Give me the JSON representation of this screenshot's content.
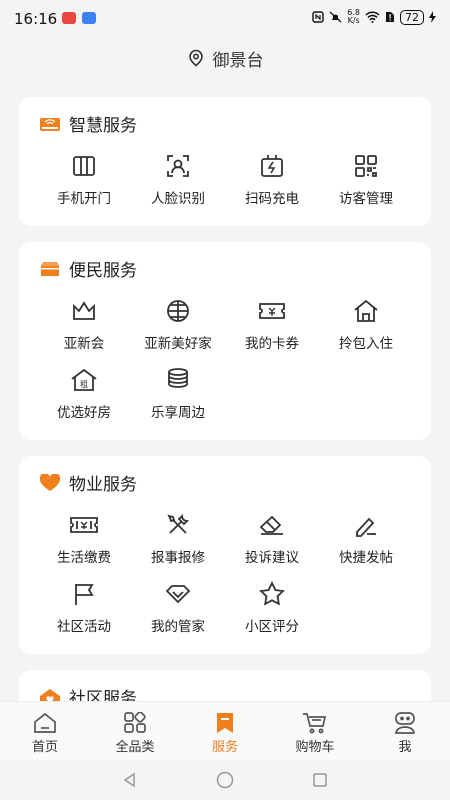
{
  "status_bar": {
    "time": "16:16",
    "speed_value": "6.8",
    "speed_unit": "K/s",
    "battery": "72"
  },
  "header": {
    "location": "御景台"
  },
  "colors": {
    "accent": "#f07f1e",
    "icon_stroke": "#333333"
  },
  "sections": [
    {
      "title": "智慧服务",
      "icon": "router-icon",
      "items": [
        {
          "label": "手机开门",
          "icon": "door-icon"
        },
        {
          "label": "人脸识别",
          "icon": "face-scan-icon"
        },
        {
          "label": "扫码充电",
          "icon": "charge-icon"
        },
        {
          "label": "访客管理",
          "icon": "qrcode-icon"
        }
      ]
    },
    {
      "title": "便民服务",
      "icon": "toolbox-icon",
      "items": [
        {
          "label": "亚新会",
          "icon": "crown-icon"
        },
        {
          "label": "亚新美好家",
          "icon": "globe-icon"
        },
        {
          "label": "我的卡券",
          "icon": "coupon-icon"
        },
        {
          "label": "拎包入住",
          "icon": "house-icon"
        },
        {
          "label": "优选好房",
          "icon": "rent-house-icon"
        },
        {
          "label": "乐享周边",
          "icon": "stack-icon"
        }
      ]
    },
    {
      "title": "物业服务",
      "icon": "heart-icon",
      "items": [
        {
          "label": "生活缴费",
          "icon": "ticket-icon"
        },
        {
          "label": "报事报修",
          "icon": "tools-icon"
        },
        {
          "label": "投诉建议",
          "icon": "eraser-icon"
        },
        {
          "label": "快捷发帖",
          "icon": "edit-icon"
        },
        {
          "label": "社区活动",
          "icon": "flag-icon"
        },
        {
          "label": "我的管家",
          "icon": "butler-icon"
        },
        {
          "label": "小区评分",
          "icon": "star-icon"
        }
      ]
    },
    {
      "title": "社区服务",
      "icon": "community-icon",
      "items": []
    }
  ],
  "tabbar": [
    {
      "label": "首页",
      "icon": "home-icon"
    },
    {
      "label": "全品类",
      "icon": "category-icon"
    },
    {
      "label": "服务",
      "icon": "bookmark-icon",
      "active": true
    },
    {
      "label": "购物车",
      "icon": "cart-icon"
    },
    {
      "label": "我",
      "icon": "profile-icon"
    }
  ]
}
